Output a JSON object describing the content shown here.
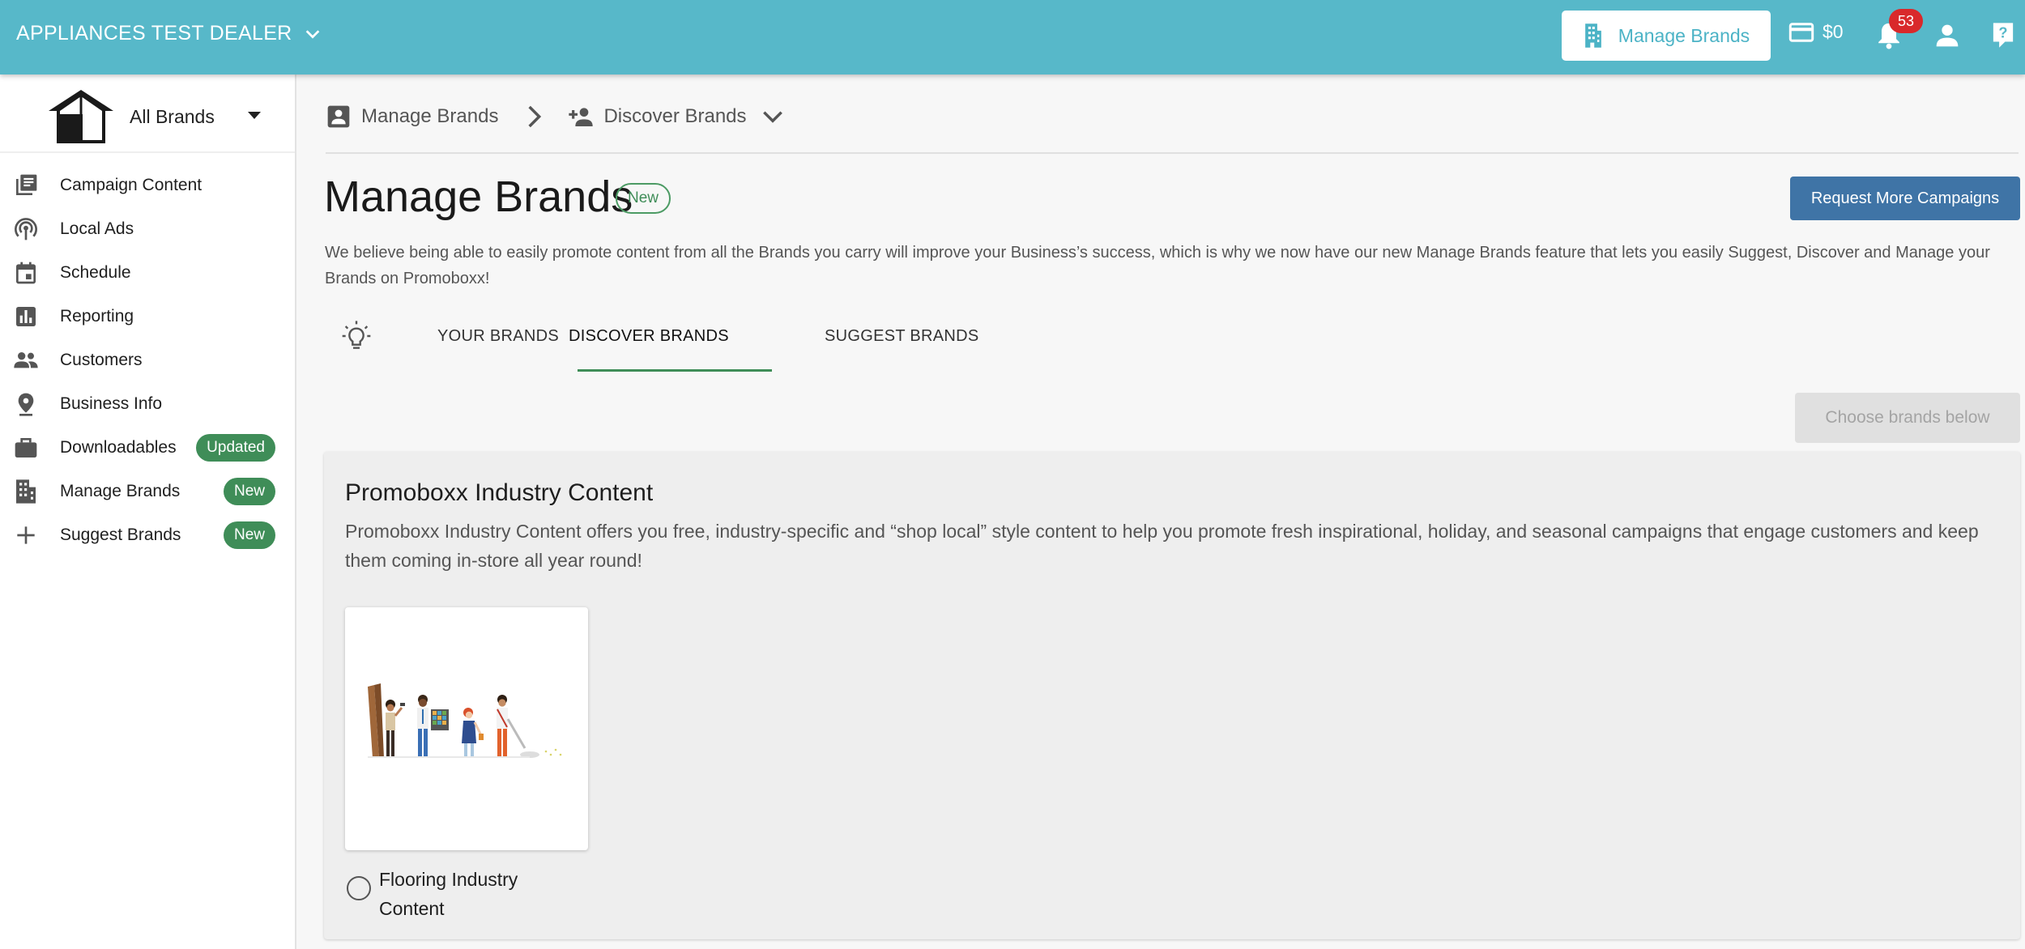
{
  "topbar": {
    "dealer_name": "APPLIANCES TEST DEALER",
    "manage_brands_label": "Manage Brands",
    "credit": "$0",
    "notification_count": "53",
    "color": "#57b8c9"
  },
  "sidebar": {
    "brand_selector": "All Brands",
    "items": [
      {
        "label": "Campaign Content",
        "icon": "library-icon"
      },
      {
        "label": "Local Ads",
        "icon": "broadcast-icon"
      },
      {
        "label": "Schedule",
        "icon": "calendar-icon"
      },
      {
        "label": "Reporting",
        "icon": "bar-chart-icon"
      },
      {
        "label": "Customers",
        "icon": "people-icon"
      },
      {
        "label": "Business Info",
        "icon": "location-pin-icon"
      },
      {
        "label": "Downloadables",
        "icon": "briefcase-icon",
        "badge": "Updated"
      },
      {
        "label": "Manage Brands",
        "icon": "building-icon",
        "badge": "New"
      },
      {
        "label": "Suggest Brands",
        "icon": "plus-icon",
        "badge": "New"
      }
    ]
  },
  "breadcrumb": {
    "item1": "Manage Brands",
    "item2": "Discover Brands"
  },
  "page": {
    "title": "Manage Brands",
    "title_badge": "New",
    "request_button": "Request More Campaigns",
    "description": "We believe being able to easily promote content from all the Brands you carry will improve your Business’s success, which is why we now have our new Manage Brands feature that lets you easily Suggest, Discover and Manage your Brands on Promoboxx!"
  },
  "tabs": [
    {
      "label": "YOUR BRANDS",
      "active": false
    },
    {
      "label": "DISCOVER BRANDS",
      "active": true
    },
    {
      "label": "SUGGEST BRANDS",
      "active": false
    }
  ],
  "choose_button": "Choose brands below",
  "section": {
    "title": "Promoboxx Industry Content",
    "description": "Promoboxx Industry Content offers you free, industry-specific and “shop local” style content to help you promote fresh inspirational, holiday, and seasonal campaigns that engage customers and keep them coming in-store all year round!",
    "cards": [
      {
        "label": "Flooring Industry Content",
        "selected": false
      }
    ]
  },
  "colors": {
    "accent_green": "#3f8d58",
    "button_blue": "#3f74a6",
    "badge_red": "#d9292b"
  }
}
